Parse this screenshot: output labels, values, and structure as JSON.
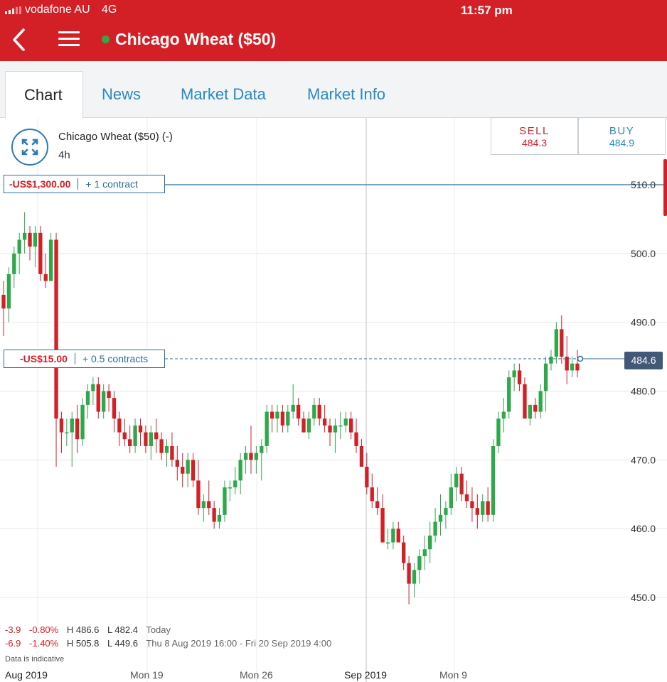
{
  "status_bar": {
    "carrier": "vodafone AU",
    "network": "4G",
    "time": "11:57 pm"
  },
  "app_bar": {
    "title": "Chicago Wheat ($50)",
    "live_dot_color": "#2ea84a"
  },
  "tabs": [
    {
      "label": "Chart",
      "active": true
    },
    {
      "label": "News",
      "active": false
    },
    {
      "label": "Market Data",
      "active": false
    },
    {
      "label": "Market Info",
      "active": false
    }
  ],
  "instrument": {
    "name": "Chicago Wheat ($50) (-)",
    "interval": "4h"
  },
  "deal": {
    "sell_label": "SELL",
    "sell_price": "484.3",
    "buy_label": "BUY",
    "buy_price": "484.9"
  },
  "positions": [
    {
      "pnl": "-US$1,300.00",
      "qty": "+ 1 contract",
      "level": 510.0
    },
    {
      "pnl": "-US$15.00",
      "qty": "+ 0.5 contracts",
      "level": 484.9
    }
  ],
  "current_price": "484.6",
  "stats": {
    "today": {
      "change": "-3.9",
      "change_pct": "-0.80%",
      "high": "H 486.6",
      "low": "L 482.4",
      "label": "Today"
    },
    "range": {
      "change": "-6.9",
      "change_pct": "-1.40%",
      "high": "H 505.8",
      "low": "L 449.6",
      "label": "Thu 8 Aug 2019 16:00 - Fri 20 Sep 2019 4:00"
    }
  },
  "disclaimer": "Data is indicative",
  "colors": {
    "up": "#2ea84a",
    "down": "#d32027",
    "accent": "#d32027",
    "link": "#2a8ac1"
  },
  "chart_data": {
    "type": "candlestick",
    "interval": "4h",
    "y_ticks": [
      "510.0",
      "500.0",
      "490.0",
      "480.0",
      "470.0",
      "460.0",
      "450.0"
    ],
    "ylim": [
      447.2,
      512.4
    ],
    "x_ticks": [
      "Aug 2019",
      "Mon 19",
      "Mon 26",
      "Sep 2019",
      "Mon 9"
    ],
    "grid": true,
    "candles": [
      [
        494,
        496,
        488,
        492
      ],
      [
        492,
        498,
        490,
        497
      ],
      [
        497,
        501,
        495,
        500
      ],
      [
        500,
        503,
        497,
        502
      ],
      [
        502,
        506,
        500,
        503
      ],
      [
        503,
        504,
        499,
        501
      ],
      [
        501,
        504,
        498,
        503
      ],
      [
        503,
        504,
        496,
        497
      ],
      [
        497,
        500,
        495,
        496
      ],
      [
        496,
        503,
        496,
        502
      ],
      [
        502,
        503,
        469,
        476
      ],
      [
        476,
        477,
        471,
        474
      ],
      [
        474,
        476,
        472,
        474
      ],
      [
        474,
        477,
        469,
        476
      ],
      [
        476,
        478,
        471,
        473
      ],
      [
        473,
        479,
        472,
        478
      ],
      [
        478,
        481,
        476,
        480
      ],
      [
        480,
        482,
        478,
        481
      ],
      [
        481,
        482,
        476,
        477
      ],
      [
        477,
        481,
        476,
        480
      ],
      [
        480,
        481,
        477,
        479
      ],
      [
        479,
        480,
        474,
        476
      ],
      [
        476,
        477,
        472,
        474
      ],
      [
        474,
        476,
        472,
        473
      ],
      [
        473,
        475,
        471,
        472
      ],
      [
        472,
        476,
        471,
        475
      ],
      [
        475,
        476,
        472,
        474
      ],
      [
        474,
        475,
        471,
        472
      ],
      [
        472,
        475,
        470,
        474
      ],
      [
        474,
        476,
        471,
        473
      ],
      [
        473,
        474,
        470,
        471
      ],
      [
        471,
        473,
        469,
        472
      ],
      [
        472,
        474,
        469,
        470
      ],
      [
        470,
        472,
        467,
        469
      ],
      [
        469,
        471,
        466,
        468
      ],
      [
        468,
        471,
        466,
        470
      ],
      [
        470,
        471,
        466,
        467
      ],
      [
        467,
        470,
        462,
        463
      ],
      [
        463,
        465,
        461,
        464
      ],
      [
        464,
        467,
        462,
        463
      ],
      [
        463,
        464,
        460,
        461
      ],
      [
        461,
        463,
        460,
        462
      ],
      [
        462,
        467,
        461,
        466
      ],
      [
        466,
        467,
        464,
        466
      ],
      [
        466,
        469,
        465,
        467
      ],
      [
        467,
        471,
        465,
        470
      ],
      [
        470,
        472,
        468,
        471
      ],
      [
        471,
        475,
        468,
        470
      ],
      [
        470,
        472,
        468,
        471
      ],
      [
        471,
        473,
        467,
        472
      ],
      [
        472,
        478,
        471,
        477
      ],
      [
        477,
        478,
        474,
        476
      ],
      [
        476,
        478,
        474,
        477
      ],
      [
        477,
        478,
        474,
        475
      ],
      [
        475,
        478,
        474,
        477
      ],
      [
        477,
        481,
        476,
        478
      ],
      [
        478,
        479,
        475,
        476
      ],
      [
        476,
        477,
        474,
        474
      ],
      [
        474,
        477,
        473,
        476
      ],
      [
        476,
        479,
        475,
        478
      ],
      [
        478,
        479,
        475,
        476
      ],
      [
        476,
        478,
        474,
        475
      ],
      [
        475,
        476,
        472,
        474
      ],
      [
        474,
        476,
        471,
        475
      ],
      [
        475,
        477,
        473,
        475
      ],
      [
        475,
        477,
        474,
        476
      ],
      [
        476,
        477,
        473,
        474
      ],
      [
        474,
        476,
        471,
        472
      ],
      [
        472,
        473,
        469,
        469
      ],
      [
        469,
        471,
        465,
        466
      ],
      [
        466,
        468,
        463,
        464
      ],
      [
        464,
        466,
        462,
        463
      ],
      [
        463,
        465,
        458,
        458
      ],
      [
        458,
        460,
        457,
        458
      ],
      [
        458,
        461,
        457,
        460
      ],
      [
        460,
        461,
        458,
        458
      ],
      [
        458,
        459,
        454,
        455
      ],
      [
        455,
        456,
        449,
        452
      ],
      [
        452,
        455,
        450,
        454
      ],
      [
        454,
        457,
        452,
        456
      ],
      [
        456,
        459,
        454,
        457
      ],
      [
        457,
        461,
        455,
        459
      ],
      [
        459,
        463,
        458,
        461
      ],
      [
        461,
        465,
        459,
        462
      ],
      [
        462,
        464,
        460,
        463
      ],
      [
        463,
        468,
        462,
        466
      ],
      [
        466,
        469,
        464,
        468
      ],
      [
        468,
        469,
        464,
        465
      ],
      [
        465,
        467,
        463,
        464
      ],
      [
        464,
        466,
        461,
        463
      ],
      [
        463,
        465,
        460,
        462
      ],
      [
        462,
        465,
        461,
        464
      ],
      [
        464,
        466,
        461,
        462
      ],
      [
        462,
        473,
        461,
        472
      ],
      [
        472,
        477,
        471,
        476
      ],
      [
        476,
        479,
        474,
        477
      ],
      [
        477,
        483,
        476,
        482
      ],
      [
        482,
        484,
        480,
        483
      ],
      [
        483,
        484,
        480,
        481
      ],
      [
        481,
        482,
        476,
        476
      ],
      [
        476,
        478,
        475,
        478
      ],
      [
        478,
        479,
        476,
        477
      ],
      [
        477,
        481,
        476,
        480
      ],
      [
        480,
        485,
        477,
        484
      ],
      [
        484,
        486,
        483,
        485
      ],
      [
        485,
        490,
        484,
        489
      ],
      [
        489,
        491,
        484,
        485
      ],
      [
        485,
        488,
        481,
        483
      ],
      [
        483,
        485,
        482,
        484
      ],
      [
        484,
        486,
        482,
        483
      ]
    ]
  }
}
